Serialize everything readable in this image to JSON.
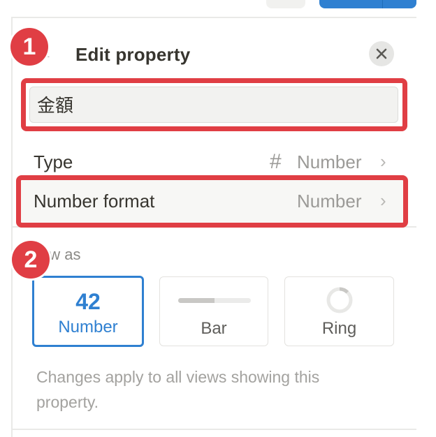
{
  "header": {
    "title": "Edit property"
  },
  "name_field": {
    "value": "金額"
  },
  "rows": {
    "type": {
      "label": "Type",
      "icon_glyph": "#",
      "value": "Number"
    },
    "number_format": {
      "label": "Number format",
      "value": "Number"
    }
  },
  "show_as": {
    "label": "Show as",
    "label_visible": "ow as",
    "options": [
      {
        "big": "42",
        "label": "Number",
        "selected": true
      },
      {
        "label": "Bar",
        "selected": false
      },
      {
        "label": "Ring",
        "selected": false
      }
    ]
  },
  "note": "Changes apply to all views showing this property.",
  "annotations": {
    "badge_1": "1",
    "badge_2": "2",
    "color": "#e03e44"
  },
  "colors": {
    "accent": "#2f80d1",
    "text": "#37352f",
    "muted": "#9b9a97"
  }
}
